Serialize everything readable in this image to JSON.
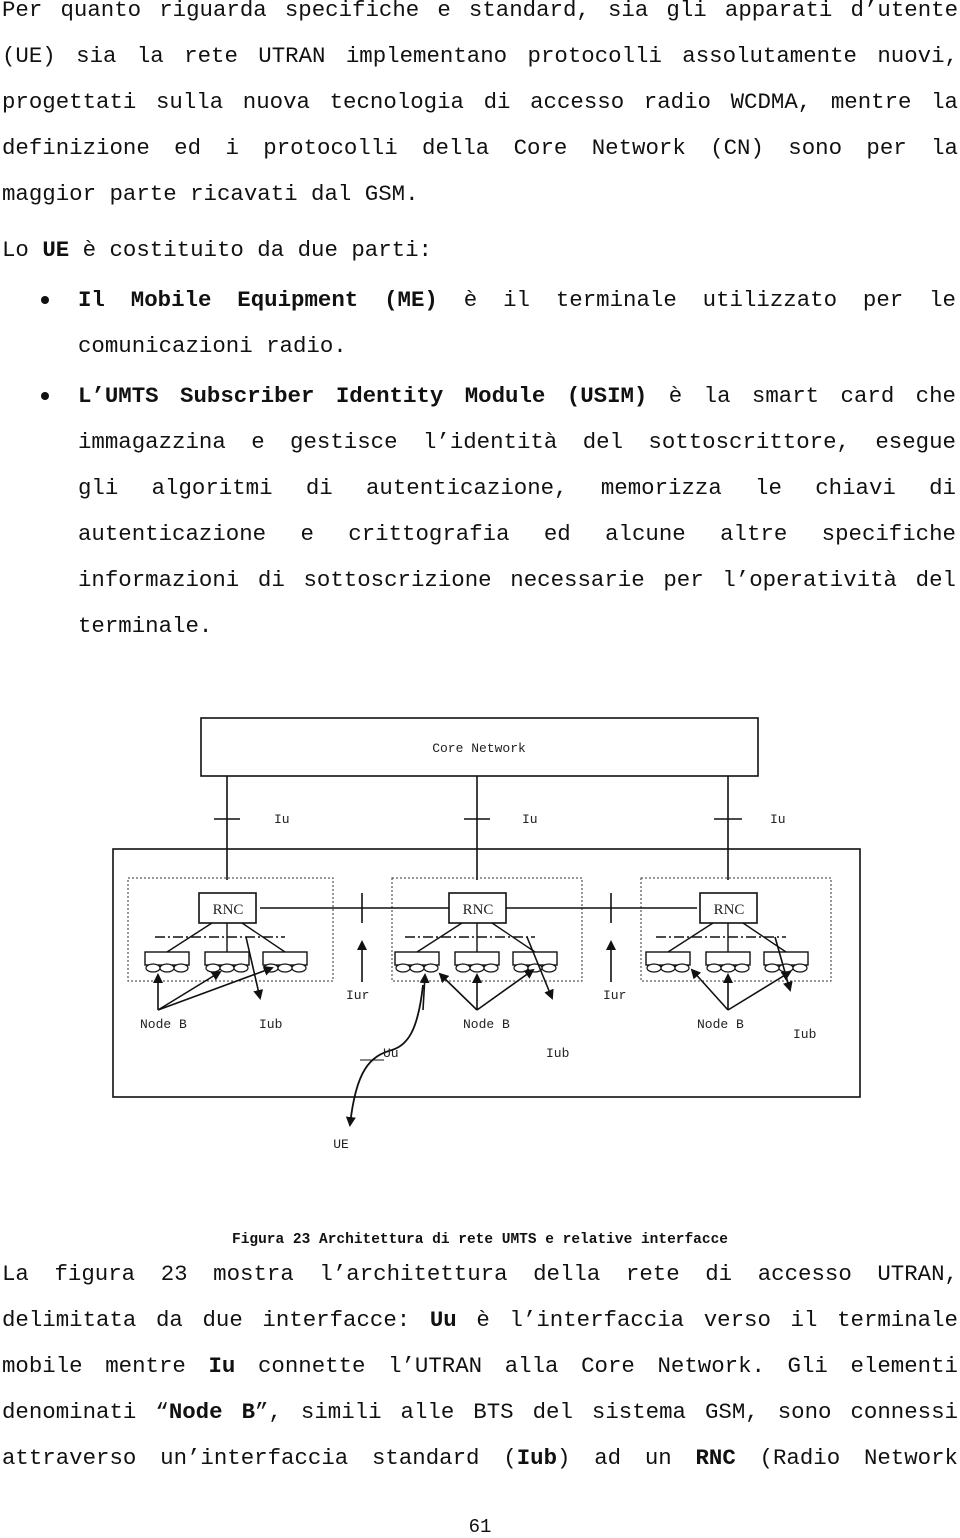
{
  "paragraph_1": {
    "lines": [
      "Per quanto riguarda specifiche e standard, sia gli apparati d’utente",
      "(UE) sia la rete UTRAN implementano protocolli assolutamente nuovi,",
      "progettati sulla nuova tecnologia di accesso radio WCDMA, mentre la",
      "definizione ed i protocolli della Core Network (CN) sono per la",
      "maggior parte ricavati dal GSM."
    ]
  },
  "paragraph_2": {
    "prefix": "Lo ",
    "bold": "UE",
    "suffix": " è costituito da due parti:"
  },
  "bullets": [
    {
      "bold": "Il Mobile Equipment (ME)",
      "line_1_rest": " è il terminale utilizzato per le",
      "lines": [
        "comunicazioni radio."
      ]
    },
    {
      "bold": "L’UMTS Subscriber Identity Module (USIM)",
      "line_1_rest": " è la smart card che",
      "lines": [
        "immagazzina e gestisce l’identità del sottoscrittore, esegue",
        "gli algoritmi di autenticazione, memorizza le chiavi di",
        "autenticazione e crittografia ed alcune altre specifiche",
        "informazioni di sottoscrizione necessarie per l’operatività del",
        "terminale."
      ]
    }
  ],
  "diagram": {
    "core_network_label": "Core Network",
    "iu_labels": [
      "Iu",
      "Iu",
      "Iu"
    ],
    "rnc_labels": [
      "RNC",
      "RNC",
      "RNC"
    ],
    "iur_labels": [
      "Iur",
      "Iur"
    ],
    "node_b_labels": [
      "Node B",
      "Node B",
      "Node B"
    ],
    "iub_labels": [
      "Iub",
      "Iub",
      "Iub"
    ],
    "uu_label": "Uu",
    "ue_label": "UE"
  },
  "caption": "Figura 23 Architettura di rete UMTS e relative interfacce",
  "paragraph_3": {
    "line_1": "La figura 23 mostra l’architettura della rete di accesso UTRAN,",
    "line_2": {
      "a": "delimitata da due interfacce: ",
      "b": "Uu",
      "c": " è l’interfaccia verso il terminale"
    },
    "line_3": {
      "a": "mobile mentre ",
      "b": "Iu",
      "c": " connette l’UTRAN alla Core Network. Gli elementi"
    },
    "line_4": {
      "a": "denominati “",
      "b": "Node B",
      "c": "”, simili alle BTS del sistema GSM, sono connessi"
    },
    "line_5": {
      "a": "attraverso un’interfaccia standard (",
      "b": "Iub",
      "c": ") ad un ",
      "d": "RNC",
      "e": " (Radio Network"
    }
  },
  "page_number": "61"
}
